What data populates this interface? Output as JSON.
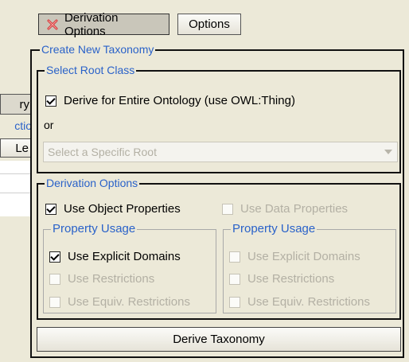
{
  "toolbar": {
    "derivation_options_label": "Derivation Options",
    "options_label": "Options"
  },
  "background_panel": {
    "tab_fragment": "ry",
    "link_fragment": "ctio",
    "button_fragment": "Le"
  },
  "dialog": {
    "title": "Create New Taxonomy",
    "root_group": {
      "legend": "Select Root Class",
      "derive_entire_label": "Derive for Entire Ontology (use OWL:Thing)",
      "derive_entire_checked": true,
      "or_label": "or",
      "select_placeholder": "Select a Specific Root"
    },
    "derivation_group": {
      "legend": "Derivation Options",
      "use_object_properties_label": "Use Object Properties",
      "use_object_properties_checked": true,
      "use_data_properties_label": "Use Data Properties",
      "use_data_properties_checked": false,
      "left_usage": {
        "legend": "Property Usage",
        "explicit_domains_label": "Use Explicit Domains",
        "explicit_domains_checked": true,
        "restrictions_label": "Use Restrictions",
        "equiv_restrictions_label": "Use Equiv. Restrictions"
      },
      "right_usage": {
        "legend": "Property Usage",
        "explicit_domains_label": "Use Explicit Domains",
        "restrictions_label": "Use Restrictions",
        "equiv_restrictions_label": "Use Equiv. Restrictions"
      }
    },
    "derive_button_label": "Derive Taxonomy"
  },
  "colors": {
    "legend_blue": "#2a62c9",
    "disabled_text": "#b3b0a4",
    "window_bg": "#ece9d8",
    "close_icon_red": "#d33a3a"
  },
  "icons": {
    "derivation_options": "red-x-icon"
  }
}
